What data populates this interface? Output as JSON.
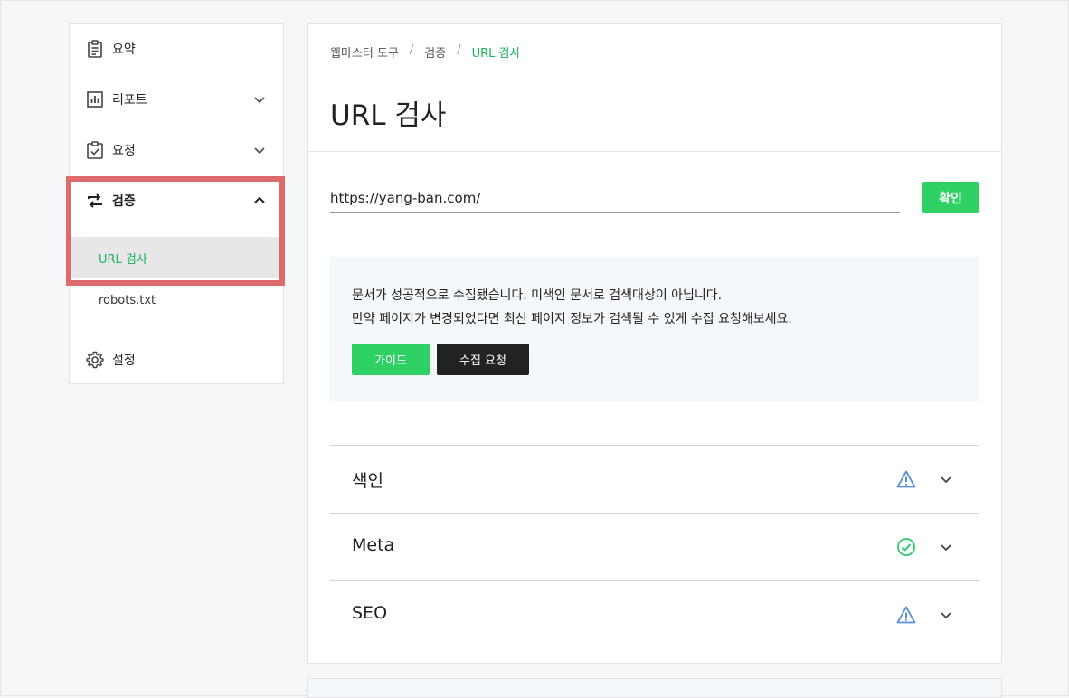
{
  "sidebar": {
    "items": [
      {
        "label": "요약",
        "icon": "clipboard-icon"
      },
      {
        "label": "리포트",
        "icon": "bar-chart-icon"
      },
      {
        "label": "요청",
        "icon": "clipboard-check-icon"
      },
      {
        "label": "검증",
        "icon": "repeat-icon"
      },
      {
        "label": "설정",
        "icon": "gear-icon"
      }
    ],
    "sub_items": [
      {
        "label": "URL 검사"
      },
      {
        "label": "robots.txt"
      }
    ]
  },
  "breadcrumb": {
    "items": [
      "웹마스터 도구",
      "검증",
      "URL 검사"
    ],
    "separator": "/"
  },
  "page_title": "URL 검사",
  "url_input": {
    "value": "https://yang-ban.com/",
    "confirm_label": "확인"
  },
  "notice": {
    "line1": "문서가 성공적으로 수집됐습니다. 미색인 문서로 검색대상이 아닙니다.",
    "line2": "만약 페이지가 변경되었다면 최신 페이지 정보가 검색될 수 있게 수집 요청해보세요.",
    "guide_label": "가이드",
    "request_label": "수집 요청"
  },
  "accordion": [
    {
      "label": "색인",
      "status": "warning-icon"
    },
    {
      "label": "Meta",
      "status": "check-circle-icon"
    },
    {
      "label": "SEO",
      "status": "warning-icon"
    }
  ],
  "colors": {
    "accent": "#2fd064",
    "active_text": "#17b35a",
    "highlight_border": "#de6b6b",
    "warning": "#5b8fd6",
    "success": "#2ec56a",
    "dark_button": "#222222"
  }
}
